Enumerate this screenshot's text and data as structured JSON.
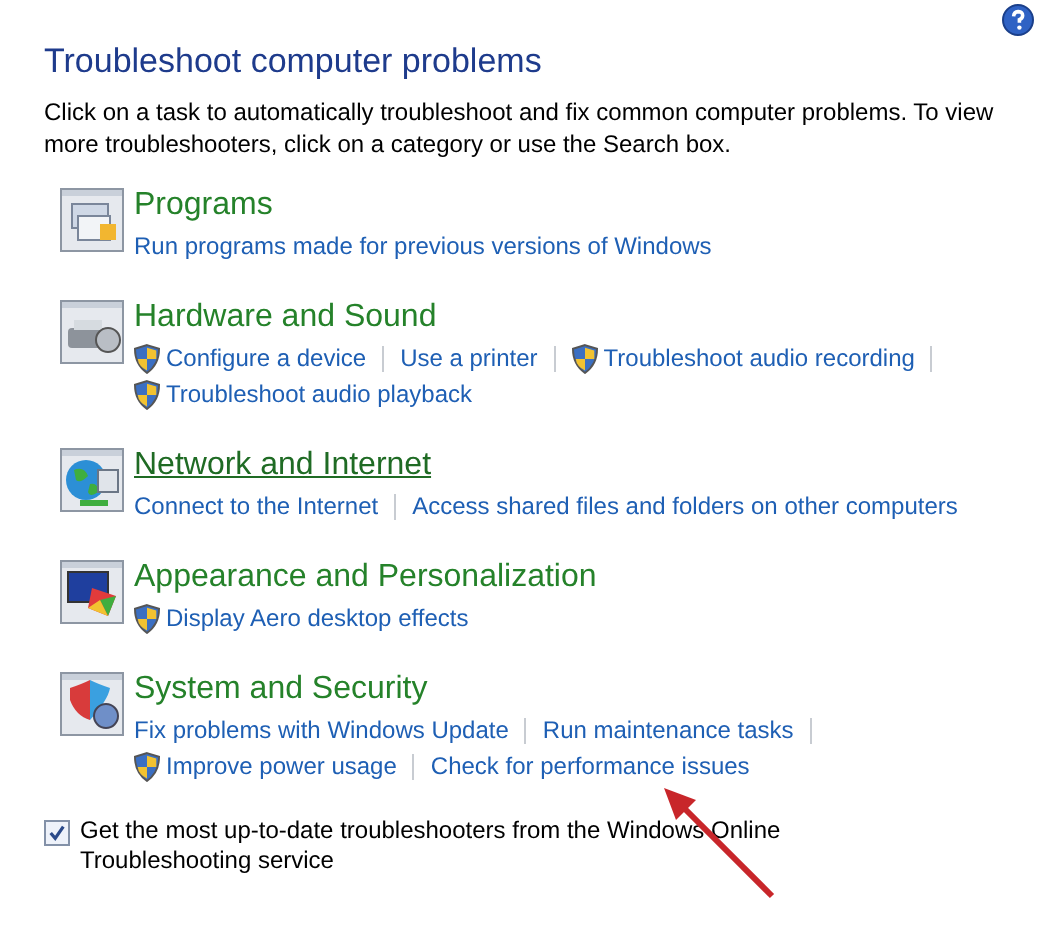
{
  "title": "Troubleshoot computer problems",
  "description": "Click on a task to automatically troubleshoot and fix common computer problems. To view more troubleshooters, click on a category or use the Search box.",
  "categories": [
    {
      "kind": "programs",
      "name": "Programs",
      "hovered": false,
      "lines": [
        [
          {
            "label": "Run programs made for previous versions of Windows",
            "shield": false
          }
        ]
      ]
    },
    {
      "kind": "hardware",
      "name": "Hardware and Sound",
      "hovered": false,
      "lines": [
        [
          {
            "label": "Configure a device",
            "shield": true
          },
          {
            "label": "Use a printer",
            "shield": false
          },
          {
            "label": "Troubleshoot audio recording",
            "shield": true
          }
        ],
        [
          {
            "label": "Troubleshoot audio playback",
            "shield": true
          }
        ]
      ]
    },
    {
      "kind": "network",
      "name": "Network and Internet",
      "hovered": true,
      "lines": [
        [
          {
            "label": "Connect to the Internet",
            "shield": false
          },
          {
            "label": "Access shared files and folders on other computers",
            "shield": false
          }
        ]
      ]
    },
    {
      "kind": "appearance",
      "name": "Appearance and Personalization",
      "hovered": false,
      "lines": [
        [
          {
            "label": "Display Aero desktop effects",
            "shield": true
          }
        ]
      ]
    },
    {
      "kind": "security",
      "name": "System and Security",
      "hovered": false,
      "lines": [
        [
          {
            "label": "Fix problems with Windows Update",
            "shield": false
          },
          {
            "label": "Run maintenance tasks",
            "shield": false
          }
        ],
        [
          {
            "label": "Improve power usage",
            "shield": true
          },
          {
            "label": "Check for performance issues",
            "shield": false
          }
        ]
      ]
    }
  ],
  "online_option": {
    "label": "Get the most up-to-date troubleshooters from the Windows Online Troubleshooting service",
    "checked": true
  },
  "annotation_arrow": true
}
